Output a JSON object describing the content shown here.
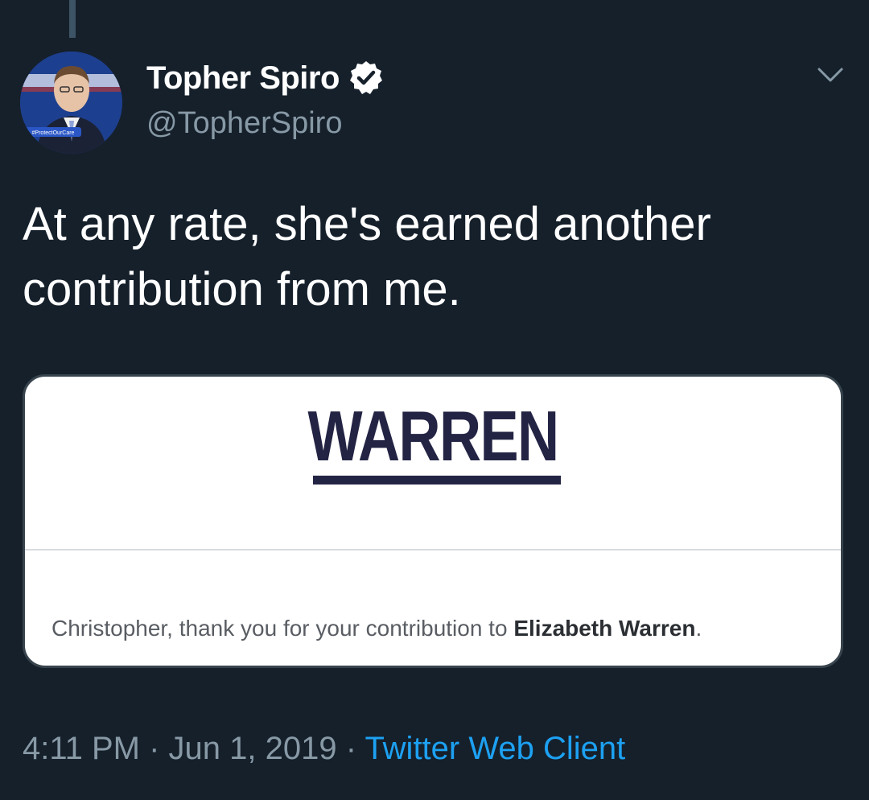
{
  "tweet": {
    "display_name": "Topher Spiro",
    "handle": "@TopherSpiro",
    "text_line1": "At any rate, she's earned another",
    "text_line2": "contribution from me.",
    "time": "4:11 PM",
    "separator": " · ",
    "date": "Jun 1, 2019",
    "client": "Twitter Web Client"
  },
  "avatar": {
    "banner_text": "#ProtectOurCare"
  },
  "media": {
    "logo_text": "WARREN",
    "message_prefix": "Christopher, thank you for your contribution to ",
    "message_bold": "Elizabeth Warren",
    "message_suffix": "."
  },
  "icons": {
    "verified": "verified-badge-icon",
    "caret": "chevron-down-icon"
  },
  "colors": {
    "background": "#15202b",
    "secondary_text": "#8899a6",
    "link": "#1da1f2",
    "logo_navy": "#232444"
  }
}
